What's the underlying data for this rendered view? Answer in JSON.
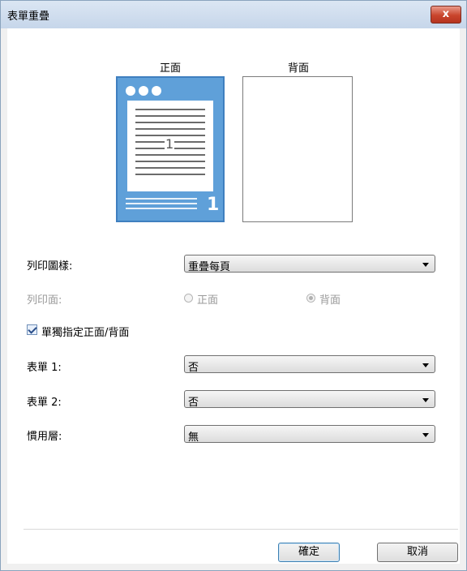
{
  "window": {
    "title": "表單重疊",
    "close_label": "x"
  },
  "preview": {
    "front_label": "正面",
    "back_label": "背面",
    "page_number": "1",
    "badge_number": "1",
    "colors": {
      "front_bg": "#5fa0d9",
      "back_bg": "#ffffff"
    }
  },
  "form": {
    "print_pattern": {
      "label": "列印圖樣:",
      "value": "重疊每頁"
    },
    "print_side": {
      "label": "列印面:",
      "option_front": "正面",
      "option_back": "背面",
      "selected": "背面",
      "disabled": true
    },
    "separate_checkbox": {
      "label": "單獨指定正面/背面",
      "checked": true
    },
    "form1": {
      "label": "表單 1:",
      "value": "否"
    },
    "form2": {
      "label": "表單 2:",
      "value": "否"
    },
    "custom_layer": {
      "label": "慣用層:",
      "value": "無"
    }
  },
  "buttons": {
    "ok": "確定",
    "cancel": "取消"
  }
}
